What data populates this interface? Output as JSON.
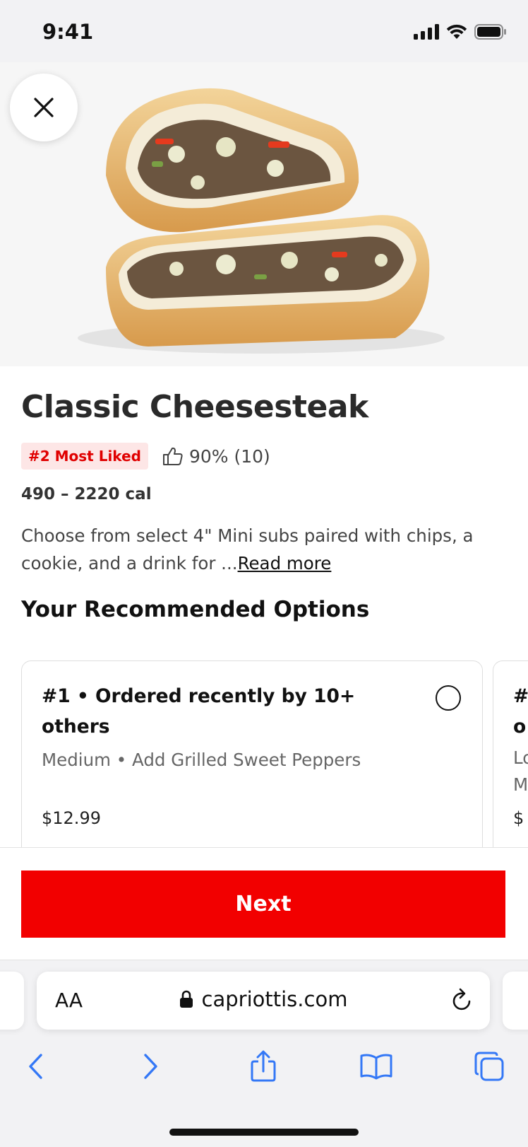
{
  "status_bar": {
    "time": "9:41"
  },
  "product": {
    "title": "Classic Cheesesteak",
    "badge": "#2 Most Liked",
    "rating": "90% (10)",
    "calories": "490 – 2220 cal",
    "description": "Choose from select 4\" Mini subs paired with chips, a cookie, and a drink for ...",
    "read_more": "Read more"
  },
  "recommended": {
    "title": "Your Recommended Options",
    "options": [
      {
        "title": "#1 • Ordered recently by 10+ others",
        "details": "Medium • Add Grilled Sweet Peppers",
        "price": "$12.99",
        "selected": false
      },
      {
        "title_line1": "#",
        "title_line2": "o",
        "details": "Lo\nM",
        "price": "$"
      }
    ]
  },
  "actions": {
    "next_label": "Next"
  },
  "browser": {
    "text_size_label": "AA",
    "url": "capriottis.com"
  },
  "colors": {
    "accent": "#f20000",
    "badge_bg": "#fde6e6",
    "ios_blue": "#3478f6"
  },
  "icons": [
    "close-icon",
    "thumbs-up-icon",
    "lock-icon",
    "reload-icon",
    "back-icon",
    "forward-icon",
    "share-icon",
    "bookmarks-icon",
    "tabs-icon",
    "signal-icon",
    "wifi-icon",
    "battery-icon"
  ]
}
